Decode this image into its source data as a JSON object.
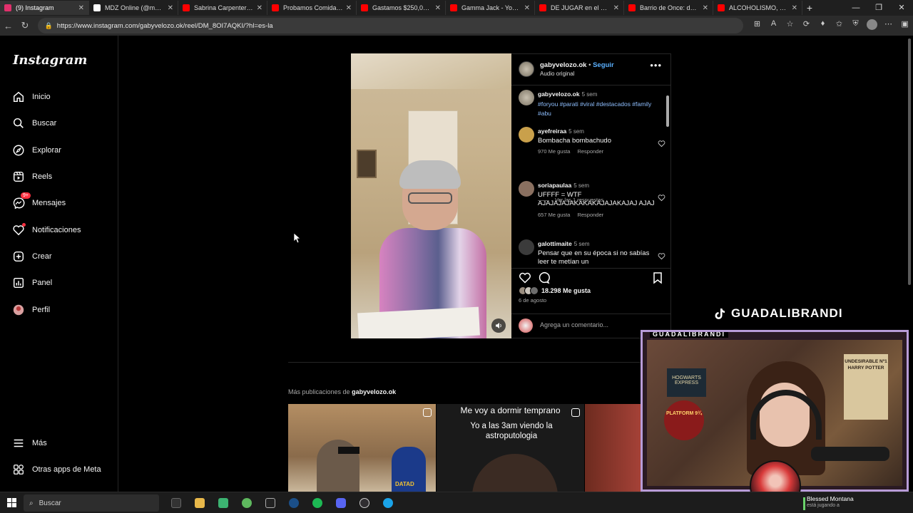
{
  "browser": {
    "tabs": [
      {
        "title": "(9) Instagram",
        "color": "#e1306c",
        "active": true
      },
      {
        "title": "MDZ Online (@mdzol) / X",
        "color": "#ffffff"
      },
      {
        "title": "Sabrina Carpenter - Jun",
        "color": "#ff0000"
      },
      {
        "title": "Probamos Comida en M",
        "color": "#ff0000"
      },
      {
        "title": "Gastamos $250,000 en I",
        "color": "#ff0000"
      },
      {
        "title": "Gamma Jack - YouTube",
        "color": "#ff0000"
      },
      {
        "title": "DE JUGAR en el MADRI",
        "color": "#ff0000"
      },
      {
        "title": "Barrio de Once: de shop",
        "color": "#ff0000"
      },
      {
        "title": "ALCOHOLISMO, CAOS Y",
        "color": "#ff0000"
      }
    ],
    "url": "https://www.instagram.com/gabyvelozo.ok/reel/DM_8OI7AQKI/?hl=es-la"
  },
  "sidebar": {
    "logo": "Instagram",
    "items": [
      {
        "label": "Inicio",
        "icon": "home-icon"
      },
      {
        "label": "Buscar",
        "icon": "search-icon"
      },
      {
        "label": "Explorar",
        "icon": "compass-icon"
      },
      {
        "label": "Reels",
        "icon": "reels-icon"
      },
      {
        "label": "Mensajes",
        "icon": "messenger-icon",
        "badge": "9+"
      },
      {
        "label": "Notificaciones",
        "icon": "heart-icon"
      },
      {
        "label": "Crear",
        "icon": "plus-square-icon"
      },
      {
        "label": "Panel",
        "icon": "dashboard-icon"
      },
      {
        "label": "Perfil",
        "icon": "profile-avatar-icon"
      }
    ],
    "bottom": [
      {
        "label": "Más",
        "icon": "menu-icon"
      },
      {
        "label": "Otras apps de Meta",
        "icon": "apps-icon"
      }
    ]
  },
  "post": {
    "username": "gabyvelozo.ok",
    "separator": "•",
    "follow": "Seguir",
    "audio": "Audio original",
    "caption": {
      "user": "gabyvelozo.ok",
      "time": "5 sem",
      "tags": "#foryou #parati #viral #destacados #family #abu"
    },
    "comments": [
      {
        "user": "ayefreiraa",
        "time": "5 sem",
        "text": "Bombacha bombachudo",
        "likes": "970 Me gusta",
        "reply": "Responder",
        "color": "#c9a04b"
      },
      {
        "user": "soriapaulaa",
        "time": "5 sem",
        "text": "UFFFF = WTF AJAJAJAJAKAKAKAJAJAKAJAJ AJAJ",
        "likes": "657 Me gusta",
        "reply": "Responder",
        "color": "#8a7060"
      },
      {
        "user": "galottimaite",
        "time": "5 sem",
        "text": "Pensar que en su época si no sabías leer te metían un",
        "color": "#3b3b3b"
      }
    ],
    "view_replies": "Ver las 1 respuestas",
    "likes": "18.298 Me gusta",
    "date": "6 de agosto",
    "add_comment_placeholder": "Agrega un comentario..."
  },
  "more": {
    "prefix": "Más publicaciones de",
    "user": "gabyvelozo.ok",
    "thumb2_line1": "Me voy a dormir temprano",
    "thumb2_line2": "Yo a las 3am viendo la astroputologia",
    "thumb1_jersey": "DATAD"
  },
  "stream": {
    "tiktok_handle": "GUADALIBRANDI",
    "cam_label": "GUADALIBRANDI",
    "poster_hogwarts": "HOGWARTS EXPRESS",
    "poster_platform": "PLATFORM 9¾",
    "poster_wanted": "UNDESIRABLE Nº1 HARRY POTTER",
    "accent": "#b89cd8"
  },
  "taskbar": {
    "search": "Buscar",
    "now_playing_title": "Blessed Montana",
    "now_playing_sub": "está jugando a"
  }
}
